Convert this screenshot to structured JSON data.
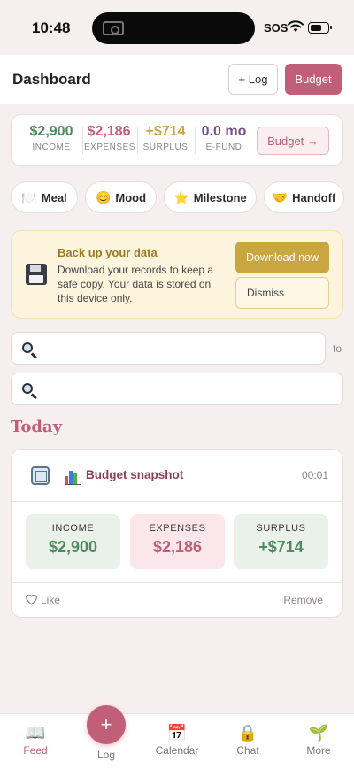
{
  "status_bar": {
    "time": "10:48",
    "sos": "SOS"
  },
  "header": {
    "title": "Dashboard",
    "log_label": "+ Log",
    "budget_label": "Budget"
  },
  "summary": {
    "stats": [
      {
        "value": "$2,900",
        "label": "INCOME",
        "color": "#4f8a5f"
      },
      {
        "value": "$2,186",
        "label": "EXPENSES",
        "color": "#c15f78"
      },
      {
        "value": "+$714",
        "label": "SURPLUS",
        "color": "#c9a640"
      },
      {
        "value": "0.0 mo",
        "label": "E-FUND",
        "color": "#7a4e8f"
      }
    ],
    "budget_button": "Budget →"
  },
  "chips": [
    {
      "icon": "🍽️",
      "icon_name": "meal-icon",
      "label": "Meal"
    },
    {
      "icon": "😊",
      "icon_name": "mood-icon",
      "label": "Mood"
    },
    {
      "icon": "⭐",
      "icon_name": "star-icon",
      "label": "Milestone"
    },
    {
      "icon": "🤝",
      "icon_name": "handshake-icon",
      "label": "Handoff"
    }
  ],
  "backup": {
    "title": "Back up your data",
    "text": "Download your records to keep a safe copy. Your data is stored on this device only.",
    "download_label": "Download now",
    "dismiss_label": "Dismiss"
  },
  "search": {
    "from_value": "",
    "to_value": "",
    "to_label": "to"
  },
  "today": {
    "heading": "Today",
    "entry": {
      "title": "Budget snapshot",
      "time": "00:01",
      "metrics": [
        {
          "label": "INCOME",
          "value": "$2,900",
          "bg": "#e9f1ea",
          "color": "#4f8a5f"
        },
        {
          "label": "EXPENSES",
          "value": "$2,186",
          "bg": "#fbe7eb",
          "color": "#c15f78"
        },
        {
          "label": "SURPLUS",
          "value": "+$714",
          "bg": "#e9f1ea",
          "color": "#4f8a5f"
        }
      ],
      "like_label": "Like",
      "remove_label": "Remove"
    }
  },
  "nav": {
    "items": [
      {
        "label": "Feed",
        "icon": "📖",
        "icon_name": "book-icon"
      },
      {
        "label": "Log",
        "icon": "+",
        "icon_name": "plus-icon"
      },
      {
        "label": "Calendar",
        "icon": "📅",
        "icon_name": "calendar-icon"
      },
      {
        "label": "Chat",
        "icon": "🔒",
        "icon_name": "lock-icon"
      },
      {
        "label": "More",
        "icon": "🌱",
        "icon_name": "sprout-icon"
      }
    ],
    "active_color": "#c15f78"
  }
}
